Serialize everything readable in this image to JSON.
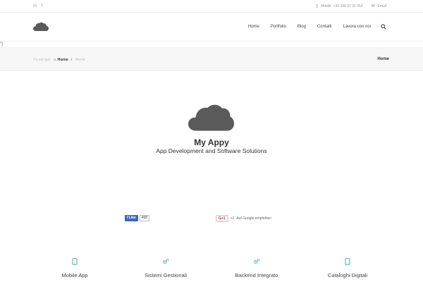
{
  "topbar": {
    "social": [
      {
        "icon": "linkedin-icon",
        "glyph": "in"
      },
      {
        "icon": "facebook-icon",
        "glyph": "f"
      }
    ],
    "mobile": "Mobile: +39 348 97 32 254",
    "email": "Email"
  },
  "nav": {
    "items": [
      "Home",
      "Portfolio",
      "Blog",
      "Contatti",
      "Lavora con noi"
    ]
  },
  "stray_text": "\"]",
  "breadcrumb": {
    "prefix": "Tu sei qui:",
    "home": "Home",
    "separator": "/",
    "current": "Home",
    "page_title": "Home"
  },
  "hero": {
    "title": "My Appy",
    "subtitle": "App Development and Software Solutions"
  },
  "facebook": {
    "label": "Like",
    "count": "458"
  },
  "gplus": {
    "label": "G+1",
    "count": "+2",
    "text": "Auf Google empfehlen"
  },
  "services": [
    {
      "label": "Mobile App",
      "icon": "tablet-icon"
    },
    {
      "label": "Sistemi Gestionali",
      "icon": "gears-icon"
    },
    {
      "label": "Backend Integrato",
      "icon": "gears-icon"
    },
    {
      "label": "Cataloghi Digitali",
      "icon": "tablet-icon"
    }
  ],
  "colors": {
    "accent": "#39b3a8",
    "cloud": "#5a5a5a",
    "facebook": "#4267b2",
    "gplus": "#d73d32"
  }
}
